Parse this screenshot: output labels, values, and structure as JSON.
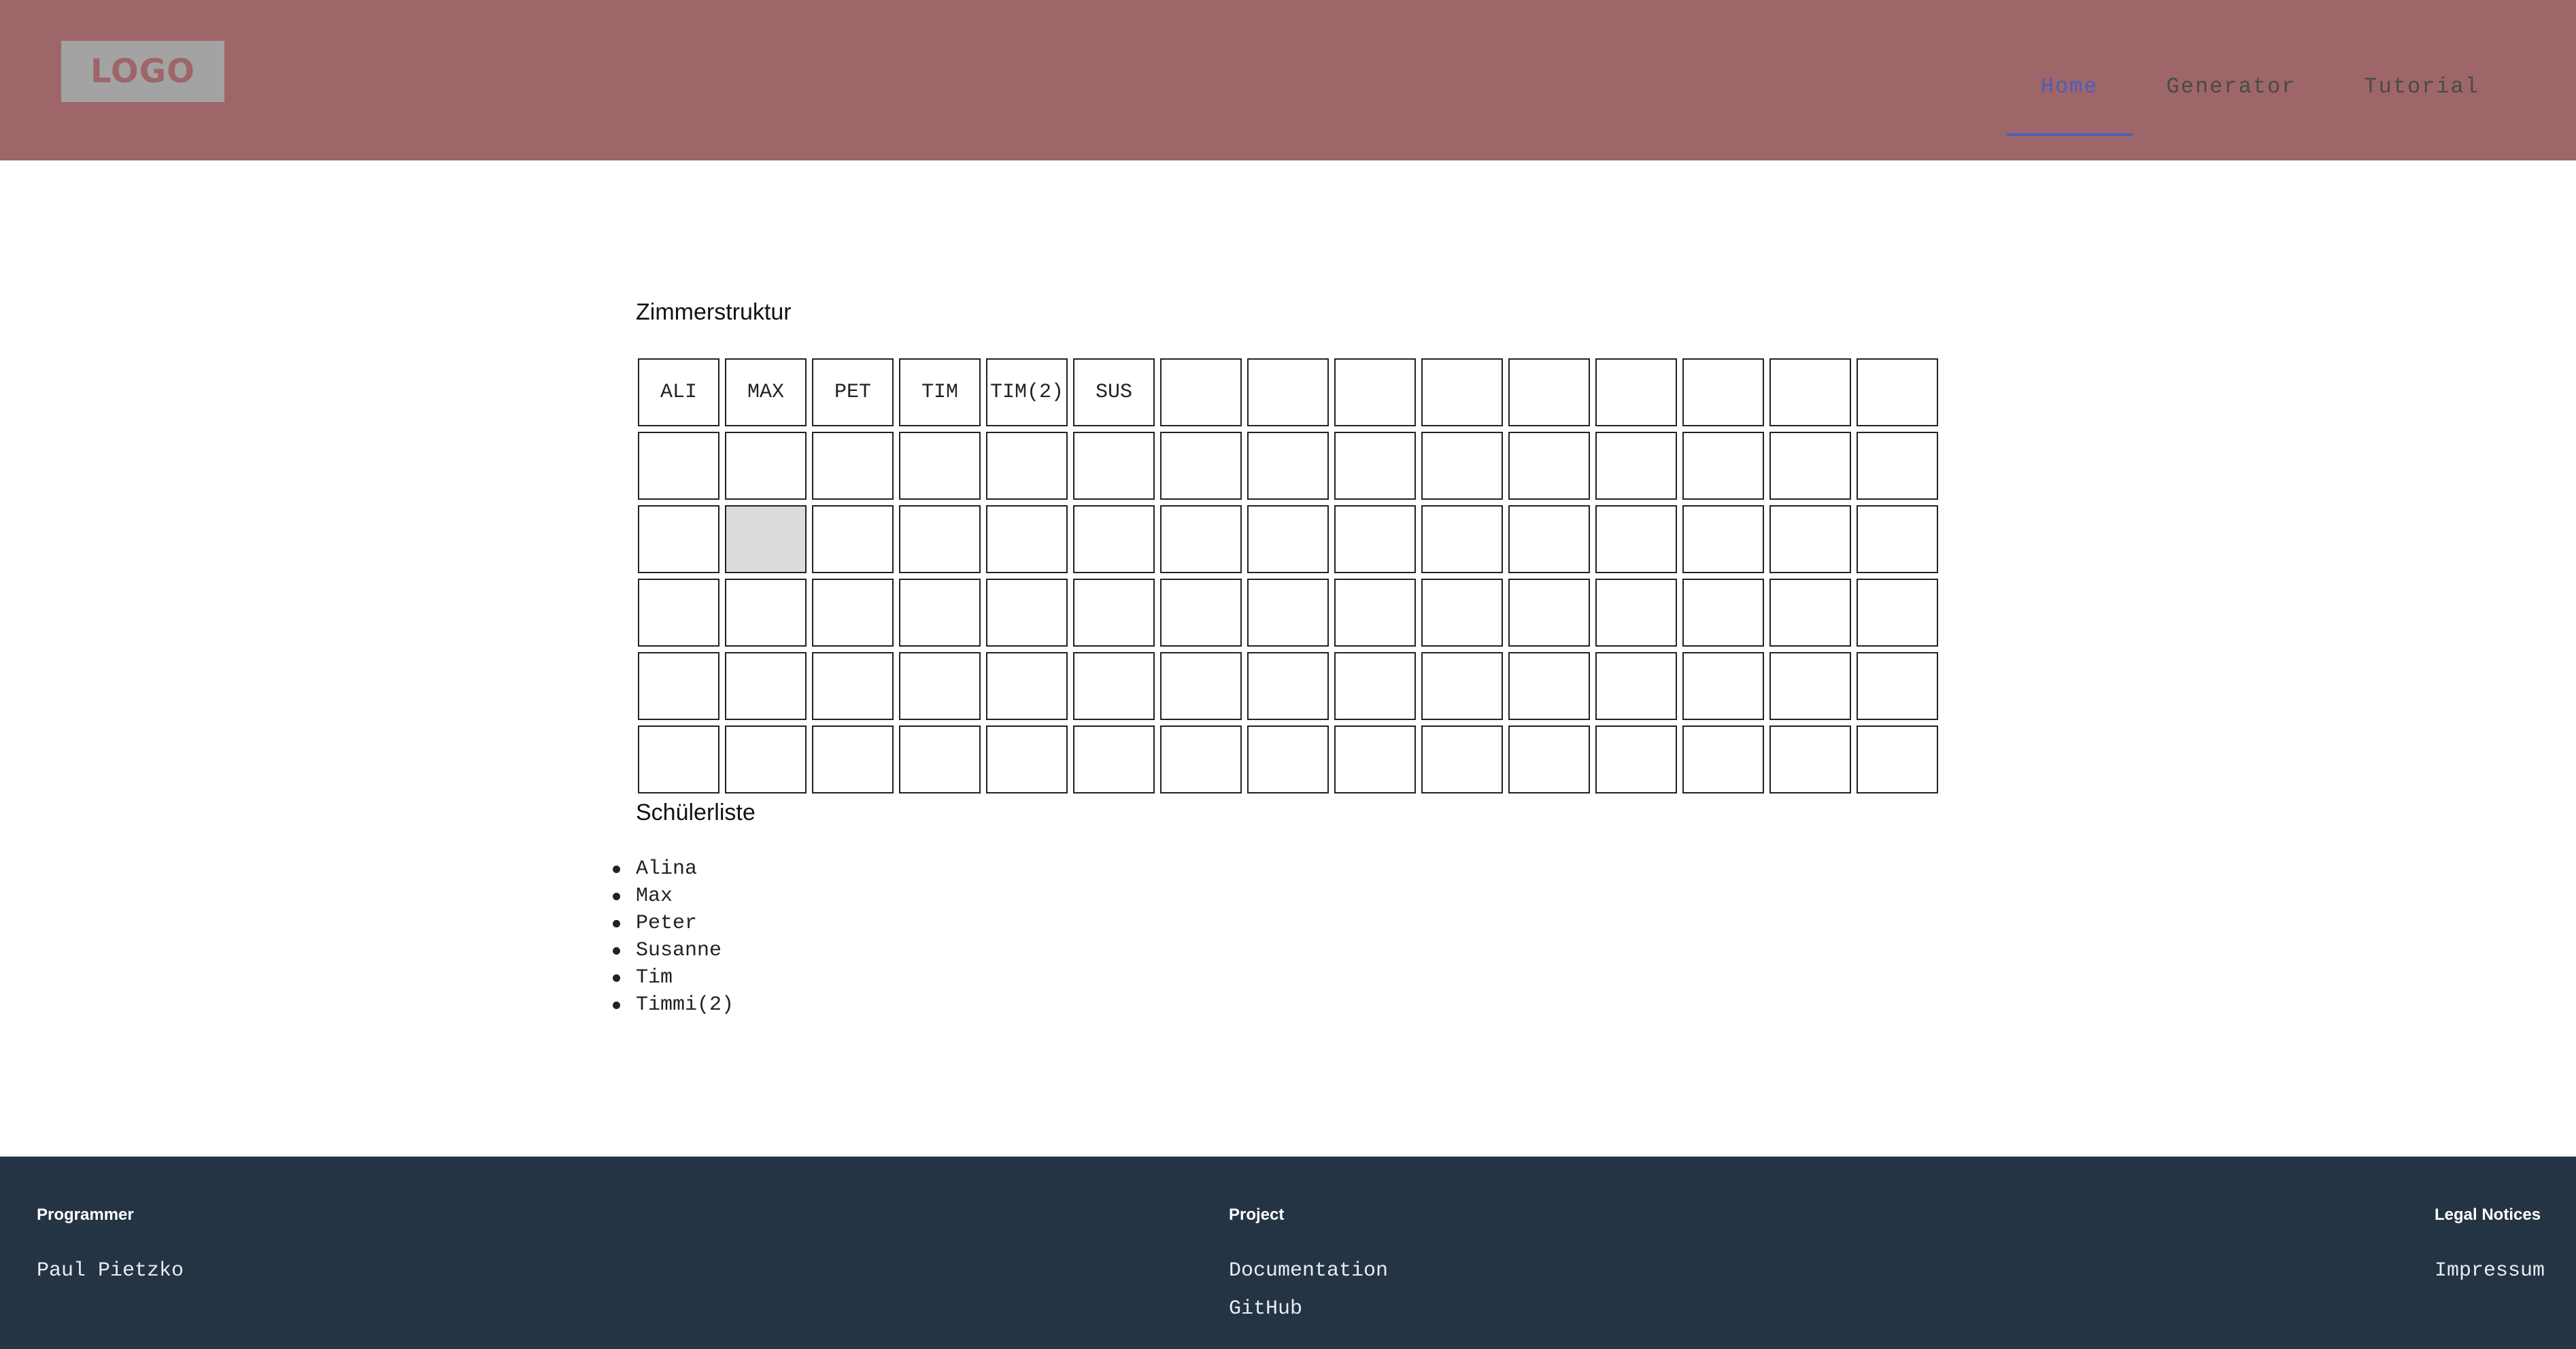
{
  "header": {
    "logo": "LOGO",
    "nav": [
      {
        "label": "Home",
        "active": true
      },
      {
        "label": "Generator",
        "active": false
      },
      {
        "label": "Tutorial",
        "active": false
      }
    ],
    "colors": {
      "background": "#9e6668",
      "active_nav": "#4b5fb8"
    }
  },
  "main": {
    "room_title": "Zimmerstruktur",
    "grid": {
      "columns": 15,
      "rows": 6,
      "first_row_labels": [
        "ALI",
        "MAX",
        "PET",
        "TIM",
        "TIM(2)",
        "SUS",
        "",
        "",
        "",
        "",
        "",
        "",
        "",
        "",
        ""
      ],
      "selected_cell": {
        "row": 3,
        "col": 2
      }
    },
    "student_title": "Schülerliste",
    "students": [
      "Alina",
      "Max",
      "Peter",
      "Susanne",
      "Tim",
      "Timmi(2)"
    ]
  },
  "footer": {
    "colors": {
      "background": "#253444"
    },
    "programmer": {
      "heading": "Programmer",
      "items": [
        "Paul Pietzko"
      ]
    },
    "project": {
      "heading": "Project",
      "items": [
        "Documentation",
        "GitHub"
      ]
    },
    "legal": {
      "heading": "Legal Notices",
      "items": [
        "Impressum"
      ]
    }
  }
}
